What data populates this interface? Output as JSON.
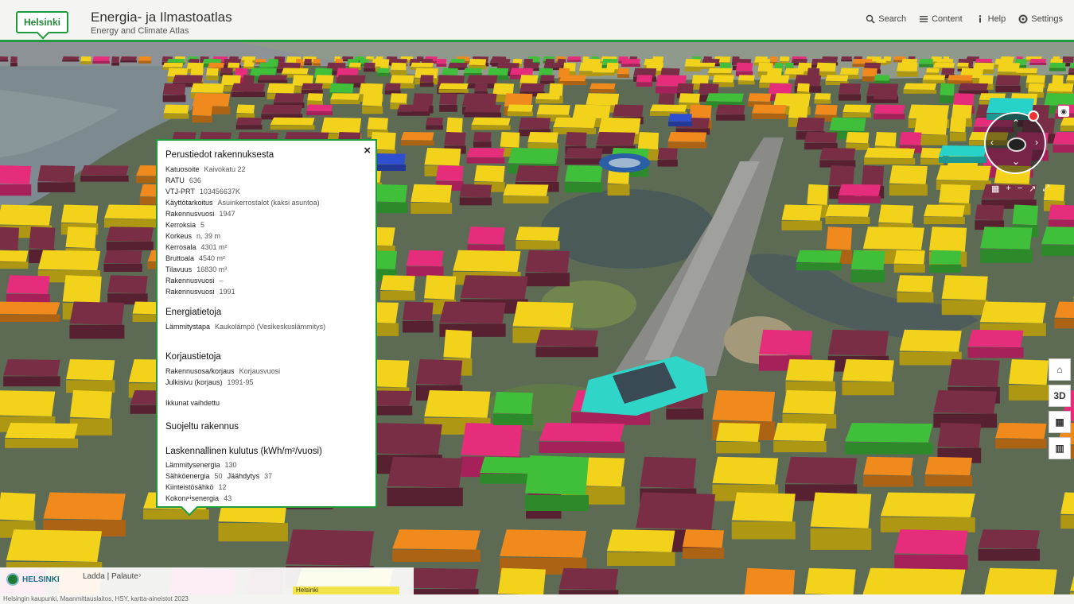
{
  "header": {
    "logo_text": "Helsinki",
    "title_fi": "Energia- ja Ilmastoatlas",
    "title_en": "Energy and Climate Atlas",
    "nav": [
      {
        "label": "Search",
        "icon": "search-icon"
      },
      {
        "label": "Content",
        "icon": "list-icon"
      },
      {
        "label": "Help",
        "icon": "info-icon"
      },
      {
        "label": "Settings",
        "icon": "gear-icon"
      }
    ]
  },
  "popup": {
    "title": "Perustiedot rakennuksesta",
    "basic": [
      {
        "k": "Katuosoite",
        "v": "Kaivokatu 22"
      },
      {
        "k": "RATU",
        "v": "636"
      },
      {
        "k": "VTJ-PRT",
        "v": "103456637K"
      },
      {
        "k": "Käyttötarkoitus",
        "v": "Asuinkerrostalot (kaksi asuntoa)"
      },
      {
        "k": "Rakennusvuosi",
        "v": "1947"
      },
      {
        "k": "Kerroksia",
        "v": "5"
      },
      {
        "k": "Korkeus",
        "v": "n. 39 m"
      },
      {
        "k": "Kerrosala",
        "v": "4301 m²"
      },
      {
        "k": "Bruttoala",
        "v": "4540 m²"
      },
      {
        "k": "Tilavuus",
        "v": "16830 m³"
      },
      {
        "k": "Rakennusvuosi",
        "v": "–"
      },
      {
        "k": "Rakennusvuosi",
        "v": "1991"
      }
    ],
    "energy_title": "Energiatietoja",
    "energy": [
      {
        "k": "Lämmitystapa",
        "v": "Kaukolämpö (Vesikeskuslämmitys)"
      }
    ],
    "repair_title": "Korjaustietoja",
    "repair": [
      {
        "k": "Rakennusosa/korjaus",
        "v": "Korjausvuosi"
      },
      {
        "k": "Julkisivu (korjaus)",
        "v": "1991-95"
      }
    ],
    "extra": "Ikkunat vaihdettu",
    "protect_title": "Suojeltu rakennus",
    "consumption_title": "Laskennallinen kulutus (kWh/m²/vuosi)",
    "consumption": [
      {
        "k": "Lämmitysenergia",
        "v": "130",
        "k2": "",
        "v2": ""
      },
      {
        "k": "Sähköenergia",
        "v": "50",
        "k2": "Jäähdytys",
        "v2": "37"
      },
      {
        "k": "Kiinteistösähkö",
        "v": "12",
        "k2": "",
        "v2": ""
      },
      {
        "k": "Kokonaisenergia",
        "v": "43",
        "k2": "",
        "v2": ""
      }
    ]
  },
  "controls": {
    "home": "⌂",
    "view3d": "3D",
    "legend": "▦",
    "basemap": "▥"
  },
  "footer": {
    "brand": "HELSINKI",
    "links": "Ladda | Palaute",
    "ext_label": "Helsinki",
    "credits": "Helsingin kaupunki, Maanmittauslaitos, HSY, kartta-aineistot 2023"
  },
  "legend_colors": {
    "yellow": "#f2d21b",
    "maroon": "#7a2e45",
    "magenta": "#e62d7c",
    "orange": "#f08a1c",
    "green": "#3fbf3a",
    "cyan": "#27d3c9",
    "blue": "#2f4fd1"
  }
}
